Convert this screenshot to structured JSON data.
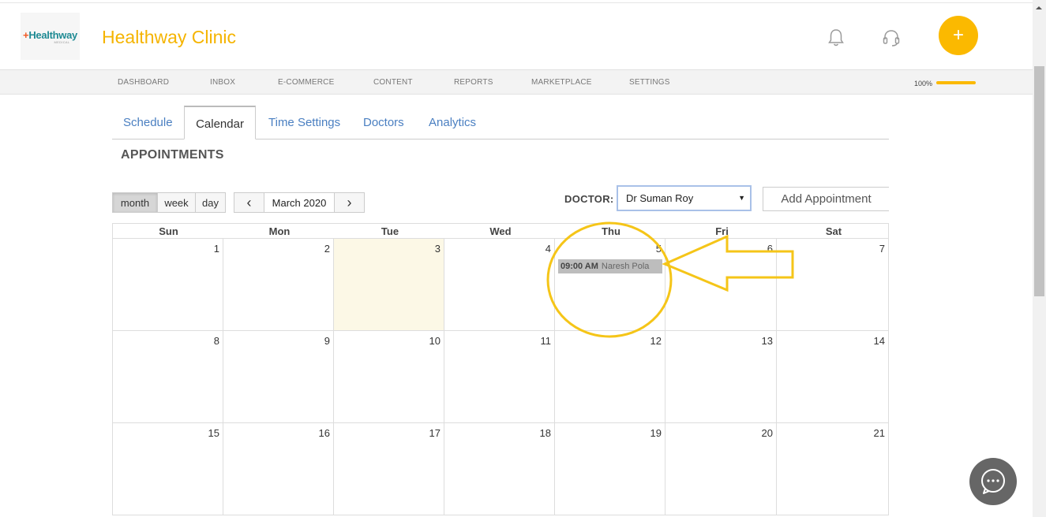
{
  "header": {
    "logo_text": "Healthway",
    "logo_sub": "MEDICAL",
    "clinic_name": "Healthway Clinic",
    "icons": [
      "bell-icon",
      "headset-icon",
      "plus-icon",
      "chat-icon"
    ],
    "plus_symbol": "+"
  },
  "nav": {
    "items": [
      "DASHBOARD",
      "INBOX",
      "E-COMMERCE",
      "CONTENT",
      "REPORTS",
      "MARKETPLACE",
      "SETTINGS"
    ],
    "zoom_label": "100%",
    "zoom_value": 1.0
  },
  "tabs": [
    "Schedule",
    "Calendar",
    "Time Settings",
    "Doctors",
    "Analytics"
  ],
  "active_tab": "Calendar",
  "section_title": "APPOINTMENTS",
  "toolbar": {
    "views": [
      "month",
      "week",
      "day"
    ],
    "active_view": "month",
    "prev_symbol": "‹",
    "next_symbol": "›",
    "current_period": "March 2020",
    "doctor_label": "DOCTOR:",
    "doctor_value": "Dr Suman Roy",
    "add_label": "Add Appointment"
  },
  "calendar": {
    "days_of_week": [
      "Sun",
      "Mon",
      "Tue",
      "Wed",
      "Thu",
      "Fri",
      "Sat"
    ],
    "weeks": [
      [
        "1",
        "2",
        "3",
        "4",
        "5",
        "6",
        "7"
      ],
      [
        "8",
        "9",
        "10",
        "11",
        "12",
        "13",
        "14"
      ],
      [
        "15",
        "16",
        "17",
        "18",
        "19",
        "20",
        "21"
      ]
    ],
    "today": "3",
    "events": [
      {
        "day": "5",
        "time": "09:00 AM",
        "name": "Naresh Pola"
      }
    ]
  },
  "colors": {
    "accent": "#fbb900",
    "brand_title": "#f5b400",
    "tab_link": "#4a7fc1",
    "today_bg": "#fcf8e6",
    "event_bg": "#bdbdbd",
    "annotation": "#f5c518"
  }
}
